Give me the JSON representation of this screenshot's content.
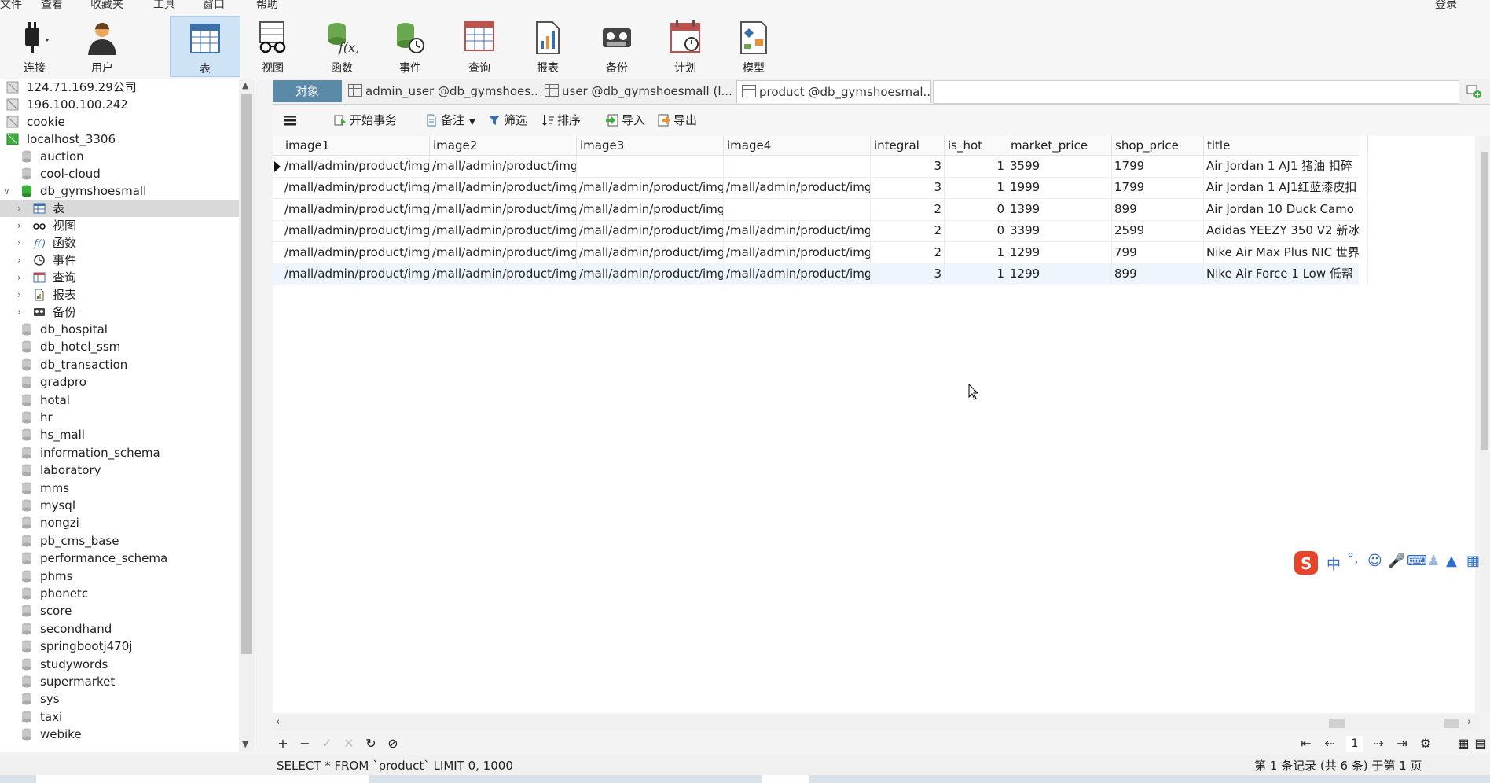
{
  "menu": {
    "items": [
      "文件",
      "查看",
      "收藏夹",
      "工具",
      "窗口",
      "帮助"
    ],
    "login": "登录"
  },
  "toolbar": {
    "connect": "连接",
    "user": "用户",
    "table": "表",
    "view": "视图",
    "function": "函数",
    "event": "事件",
    "query": "查询",
    "report": "报表",
    "backup": "备份",
    "schedule": "计划",
    "model": "模型"
  },
  "sidebar": {
    "connections": [
      "124.71.169.29公司",
      "196.100.100.242",
      "cookie",
      "localhost_3306"
    ],
    "db_open": "db_gymshoesmall",
    "objects": [
      "表",
      "视图",
      "函数",
      "事件",
      "查询",
      "报表",
      "备份"
    ],
    "databases": [
      "auction",
      "cool-cloud",
      "db_hospital",
      "db_hotel_ssm",
      "db_transaction",
      "gradpro",
      "hotal",
      "hr",
      "hs_mall",
      "information_schema",
      "laboratory",
      "mms",
      "mysql",
      "nongzi",
      "pb_cms_base",
      "performance_schema",
      "phms",
      "phonetc",
      "score",
      "secondhand",
      "springbootj470j",
      "studywords",
      "supermarket",
      "sys",
      "taxi",
      "webike"
    ]
  },
  "tabs": {
    "object": "对象",
    "items": [
      "admin_user @db_gymshoes...",
      "user @db_gymshoesmall (l...",
      "product @db_gymshoesmal..."
    ]
  },
  "gridtools": {
    "begin": "开始事务",
    "note": "备注",
    "filter": "筛选",
    "sort": "排序",
    "import": "导入",
    "export": "导出"
  },
  "grid": {
    "columns": [
      "image1",
      "image2",
      "image3",
      "image4",
      "integral",
      "is_hot",
      "market_price",
      "shop_price",
      "title"
    ],
    "rows": [
      [
        "/mall/admin/product/img",
        "/mall/admin/product/img",
        "",
        "",
        "3",
        "1",
        "3599",
        "1799",
        "Air Jordan 1 AJ1 猪油 扣碎"
      ],
      [
        "/mall/admin/product/img",
        "/mall/admin/product/img",
        "/mall/admin/product/img",
        "/mall/admin/product/img",
        "3",
        "1",
        "1999",
        "1799",
        "Air Jordan 1 AJ1红蓝漆皮扣"
      ],
      [
        "/mall/admin/product/img",
        "/mall/admin/product/img",
        "/mall/admin/product/img",
        "",
        "2",
        "0",
        "1399",
        "899",
        "Air Jordan 10 Duck Camo"
      ],
      [
        "/mall/admin/product/img",
        "/mall/admin/product/img",
        "/mall/admin/product/img",
        "/mall/admin/product/img",
        "2",
        "0",
        "3399",
        "2599",
        "Adidas YEEZY 350 V2 新冰"
      ],
      [
        "/mall/admin/product/img",
        "/mall/admin/product/img",
        "/mall/admin/product/img",
        "/mall/admin/product/img",
        "2",
        "1",
        "1299",
        "799",
        "Nike Air Max Plus NIC 世界"
      ],
      [
        "/mall/admin/product/img",
        "/mall/admin/product/img",
        "/mall/admin/product/img",
        "/mall/admin/product/img",
        "3",
        "1",
        "1299",
        "899",
        "Nike Air Force 1 Low 低帮"
      ]
    ]
  },
  "nav": {
    "page": "1"
  },
  "status": {
    "sql": "SELECT * FROM `product` LIMIT 0, 1000",
    "records": "第 1 条记录 (共 6 条) 于第 1 页"
  },
  "ime": {
    "lang": "中"
  }
}
